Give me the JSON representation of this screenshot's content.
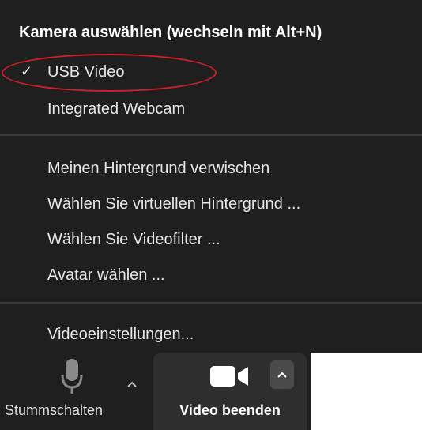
{
  "camera_menu": {
    "title": "Kamera auswählen (wechseln mit Alt+N)",
    "cameras": [
      {
        "label": "USB Video",
        "checked": true
      },
      {
        "label": "Integrated Webcam",
        "checked": false
      }
    ],
    "checkmark": "✓",
    "background_items": [
      "Meinen Hintergrund verwischen",
      "Wählen Sie virtuellen Hintergrund ...",
      "Wählen Sie Videofilter ...",
      "Avatar wählen ..."
    ],
    "settings_item": "Videoeinstellungen..."
  },
  "toolbar": {
    "mute_label": "Stummschalten",
    "video_label": "Video beenden",
    "mute_icon": "microphone-icon",
    "video_icon": "video-camera-icon",
    "chevron_icon": "chevron-up-icon"
  },
  "colors": {
    "menu_bg": "#1f1f1f",
    "highlight_ellipse": "#d21f2b",
    "active_button_bg": "#2e2e2e"
  }
}
